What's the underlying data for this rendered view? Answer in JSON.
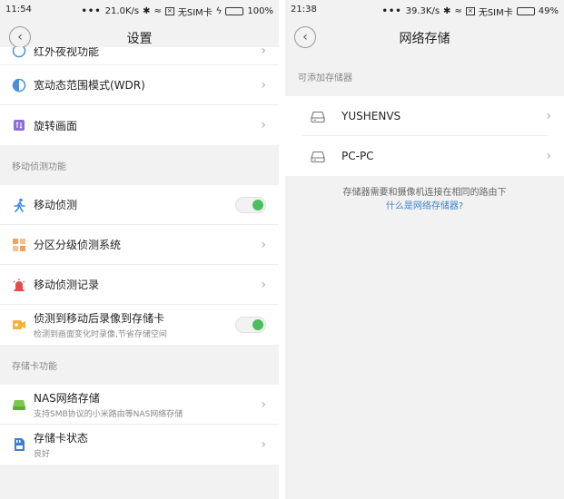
{
  "left": {
    "status": {
      "time": "11:54",
      "speed": "21.0K/s",
      "sim": "无SIM卡",
      "battery": "100%"
    },
    "title": "设置",
    "partial_row_label": "红外夜视功能",
    "rows_top": [
      {
        "label": "宽动态范围模式(WDR)"
      },
      {
        "label": "旋转画面"
      }
    ],
    "motion_section": {
      "header": "移动侦测功能",
      "rows": [
        {
          "label": "移动侦测",
          "control": "toggle",
          "on": true
        },
        {
          "label": "分区分级侦测系统",
          "control": "chevron"
        },
        {
          "label": "移动侦测记录",
          "control": "chevron"
        },
        {
          "label": "侦测到移动后录像到存储卡",
          "sub": "检测到画面变化时录像,节省存储空间",
          "control": "toggle",
          "on": true
        }
      ]
    },
    "storage_section": {
      "header": "存储卡功能",
      "rows": [
        {
          "label": "NAS网络存储",
          "sub": "支持SMB协议的小米路由等NAS网络存储"
        },
        {
          "label": "存储卡状态",
          "sub": "良好"
        }
      ]
    }
  },
  "right": {
    "status": {
      "time": "21:38",
      "speed": "39.3K/s",
      "sim": "无SIM卡",
      "battery": "49%"
    },
    "title": "网络存储",
    "section_header": "可添加存储器",
    "devices": [
      {
        "name": "YUSHENVS"
      },
      {
        "name": "PC-PC"
      }
    ],
    "note": "存储器需要和摄像机连接在相同的路由下",
    "link": "什么是网络存储器?"
  },
  "colors": {
    "toggle_on": "#4cbd5b",
    "link": "#3c82c8",
    "background": "#f2f2f2"
  }
}
